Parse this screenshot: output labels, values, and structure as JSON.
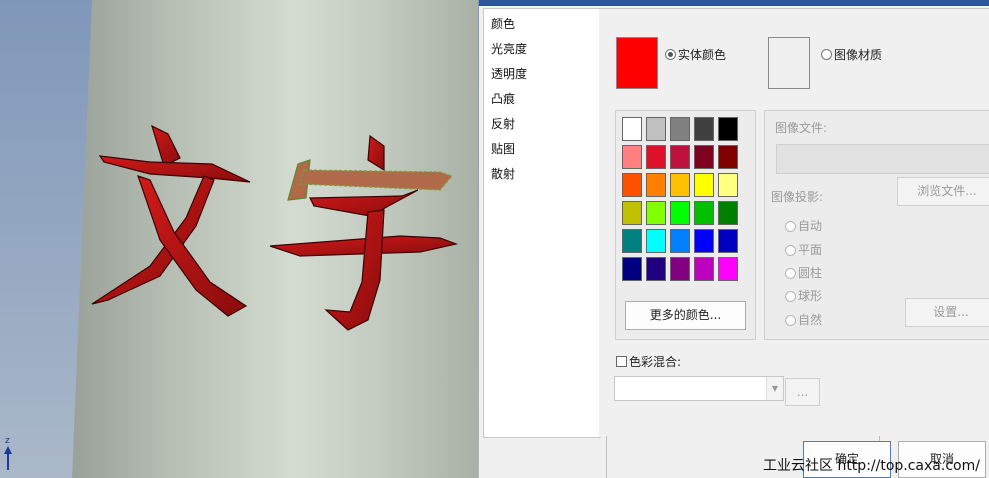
{
  "viewport": {
    "text_3d": "文字",
    "axis_label": "z"
  },
  "categories": [
    "颜色",
    "光亮度",
    "透明度",
    "凸痕",
    "反射",
    "贴图",
    "散射"
  ],
  "color_mode": {
    "solid_label": "实体颜色",
    "image_label": "图像材质",
    "selected": "solid",
    "current_color": "#ff0000"
  },
  "palette": [
    [
      "#ffffff",
      "#c0c0c0",
      "#808080",
      "#404040",
      "#000000"
    ],
    [
      "#ff8080",
      "#e0102a",
      "#c0103c",
      "#800020",
      "#800000"
    ],
    [
      "#ff5000",
      "#ff8000",
      "#ffc000",
      "#ffff00",
      "#ffff80"
    ],
    [
      "#c0c000",
      "#80ff00",
      "#00ff00",
      "#00c000",
      "#008000"
    ],
    [
      "#008080",
      "#00ffff",
      "#0080ff",
      "#0000ff",
      "#0000c0"
    ],
    [
      "#000080",
      "#200080",
      "#800080",
      "#c000c0",
      "#ff00ff"
    ]
  ],
  "more_colors_label": "更多的颜色...",
  "image_panel": {
    "file_label": "图像文件:",
    "browse_label": "浏览文件...",
    "projection_label": "图像投影:",
    "projection_options": [
      "自动",
      "平面",
      "圆柱",
      "球形",
      "自然"
    ],
    "settings_label": "设置..."
  },
  "blend": {
    "label": "色彩混合:",
    "checked": false,
    "ellipsis_label": "..."
  },
  "buttons": {
    "ok": "确定",
    "cancel": "取消"
  },
  "watermark": "工业云社区 http://top.caxa.com/"
}
